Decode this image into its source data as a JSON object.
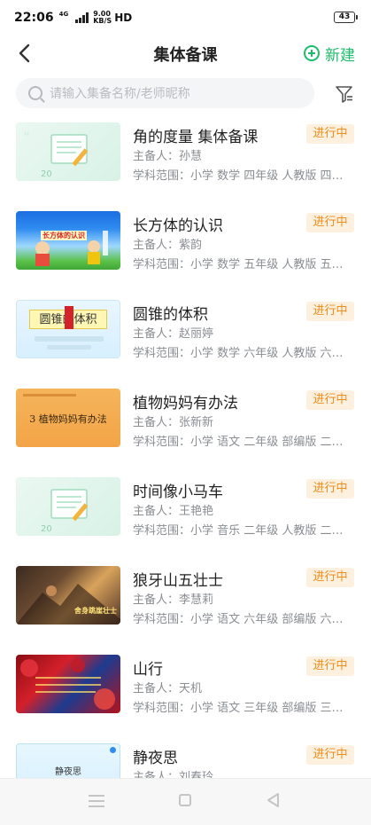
{
  "status_bar": {
    "time": "22:06",
    "network_type": "4G",
    "speed_top": "9.00",
    "speed_bottom": "KB/S",
    "hd": "HD",
    "battery": "43"
  },
  "header": {
    "title": "集体备课",
    "new_label": "新建"
  },
  "search": {
    "placeholder": "请输入集备名称/老师昵称"
  },
  "colors": {
    "accent": "#1ebc6c",
    "badge_bg": "#fdf0df",
    "badge_text": "#f08c1a"
  },
  "items": [
    {
      "title": "角的度量 集体备课",
      "status": "进行中",
      "owner": "主备人：孙慧",
      "scope": "学科范围：小学 数学 四年级 人教版 四…",
      "thumb_caption": "20",
      "thumb_style": "green"
    },
    {
      "title": "长方体的认识",
      "status": "进行中",
      "owner": "主备人：紫韵",
      "scope": "学科范围：小学 数学 五年级 人教版 五…",
      "thumb_caption": "长方体的认识",
      "thumb_style": "blue"
    },
    {
      "title": "圆锥的体积",
      "status": "进行中",
      "owner": "主备人：赵丽婷",
      "scope": "学科范围：小学 数学 六年级 人教版 六…",
      "thumb_caption": "圆锥的体积",
      "thumb_style": "cone"
    },
    {
      "title": "植物妈妈有办法",
      "status": "进行中",
      "owner": "主备人：张新新",
      "scope": "学科范围：小学 语文 二年级 部编版 二…",
      "thumb_caption": "3 植物妈妈有办法",
      "thumb_style": "orange"
    },
    {
      "title": "时间像小马车",
      "status": "进行中",
      "owner": "主备人：王艳艳",
      "scope": "学科范围：小学 音乐 二年级 人教版 二…",
      "thumb_caption": "20",
      "thumb_style": "green"
    },
    {
      "title": "狼牙山五壮士",
      "status": "进行中",
      "owner": "主备人：李慧莉",
      "scope": "学科范围：小学 语文 六年级 部编版 六…",
      "thumb_caption": "舍身跳崖壮士",
      "thumb_style": "wolf"
    },
    {
      "title": "山行",
      "status": "进行中",
      "owner": "主备人：天机",
      "scope": "学科范围：小学 语文 三年级 部编版 三…",
      "thumb_caption": "",
      "thumb_style": "red"
    },
    {
      "title": "静夜思",
      "status": "进行中",
      "owner": "主备人：刘春玲",
      "scope": "",
      "thumb_caption": "静夜思",
      "thumb_style": "light"
    }
  ]
}
